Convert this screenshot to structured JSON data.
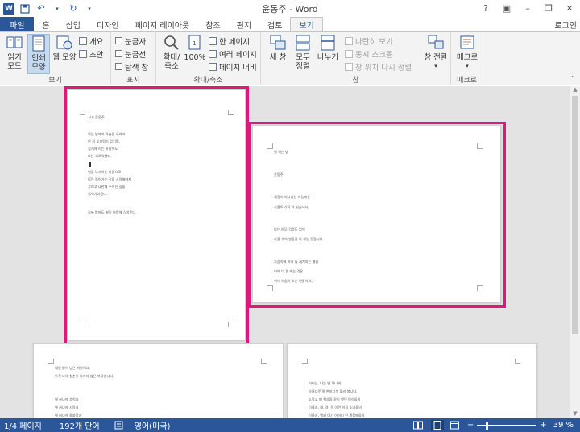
{
  "window": {
    "title": "윤동주 - Word",
    "login_label": "로그인",
    "app_icon_letter": "W"
  },
  "tabs": [
    {
      "label": "파일"
    },
    {
      "label": "홈"
    },
    {
      "label": "삽입"
    },
    {
      "label": "디자인"
    },
    {
      "label": "페이지 레이아웃"
    },
    {
      "label": "참조"
    },
    {
      "label": "편지"
    },
    {
      "label": "검토"
    },
    {
      "label": "보기"
    }
  ],
  "ribbon": {
    "views": {
      "label": "보기",
      "read_mode": "읽기\n모드",
      "print_layout": "인쇄\n모양",
      "web_layout": "웹 모양",
      "outline": "개요",
      "draft": "초안"
    },
    "show": {
      "label": "표시",
      "ruler": "눈금자",
      "gridlines": "눈금선",
      "nav_pane": "탐색 창"
    },
    "zoom": {
      "label": "확대/축소",
      "zoom": "확대/\n축소",
      "hundred": "100%",
      "one_page": "한 페이지",
      "multiple_pages": "여러 페이지",
      "page_width": "페이지 너비"
    },
    "window": {
      "label": "창",
      "new_window": "새 창",
      "arrange_all": "모두\n정렬",
      "split": "나누기",
      "side_by_side": "나란히 보기",
      "sync_scroll": "동시 스크롤",
      "reset_position": "창 위치 다시 정렬",
      "switch_windows": "창 전환"
    },
    "macros": {
      "label": "매크로",
      "macros": "매크로"
    }
  },
  "pages": {
    "page1": [
      "서시    윤동주",
      "죽는 날까지 하늘을 우러러",
      "한 점 부끄럼이 없기를,",
      "잎새에 이는 바람에도",
      "나는 괴로워했다.",
      "별을 노래하는 마음으로",
      "모든 죽어가는 것을 사랑해야지",
      "그리고 나한테 주어진 길을",
      "걸어가야겠다.",
      "오늘 밤에도 별이 바람에 스치운다."
    ],
    "page2": [
      "별 헤는 밤",
      "윤동주",
      "계절이 지나가는 하늘에는",
      "가을로 가득 차 있습니다.",
      "나는 아무 걱정도 없이",
      "가을 속의 별들을 다 헤일 듯합니다.",
      "가슴속에 하나 둘 새겨지는 별을",
      "이제 다 못 헤는 것은",
      "쉬이 아침이 오는 까닭이요,"
    ],
    "page3": [
      "내일 밤이 남은 까닭이요,",
      "아직 나의 청춘이 다하지 않은 까닭입니다.",
      "별 하나에 추억과",
      "별 하나에 사랑과",
      "별 하나에 쓸쓸함과"
    ],
    "page4": [
      "어머님, 나는 별 하나에",
      "아름다운 말 한마디씩 불러 봅니다.",
      "소학교 때 책상을 같이 했던 아이들의",
      "이름과, 패, 경, 옥 이런 이국 소녀들의",
      "이름과, 벌써 아기 어머니 된 계집애들의"
    ]
  },
  "status": {
    "page_info": "1/4 페이지",
    "word_count": "192개 단어",
    "language": "영어(미국)",
    "zoom_level": "39 %",
    "zoom_percent": 39
  },
  "colors": {
    "accent": "#2b579a",
    "highlight": "#e0187d",
    "canvas": "#e3e3e3"
  }
}
